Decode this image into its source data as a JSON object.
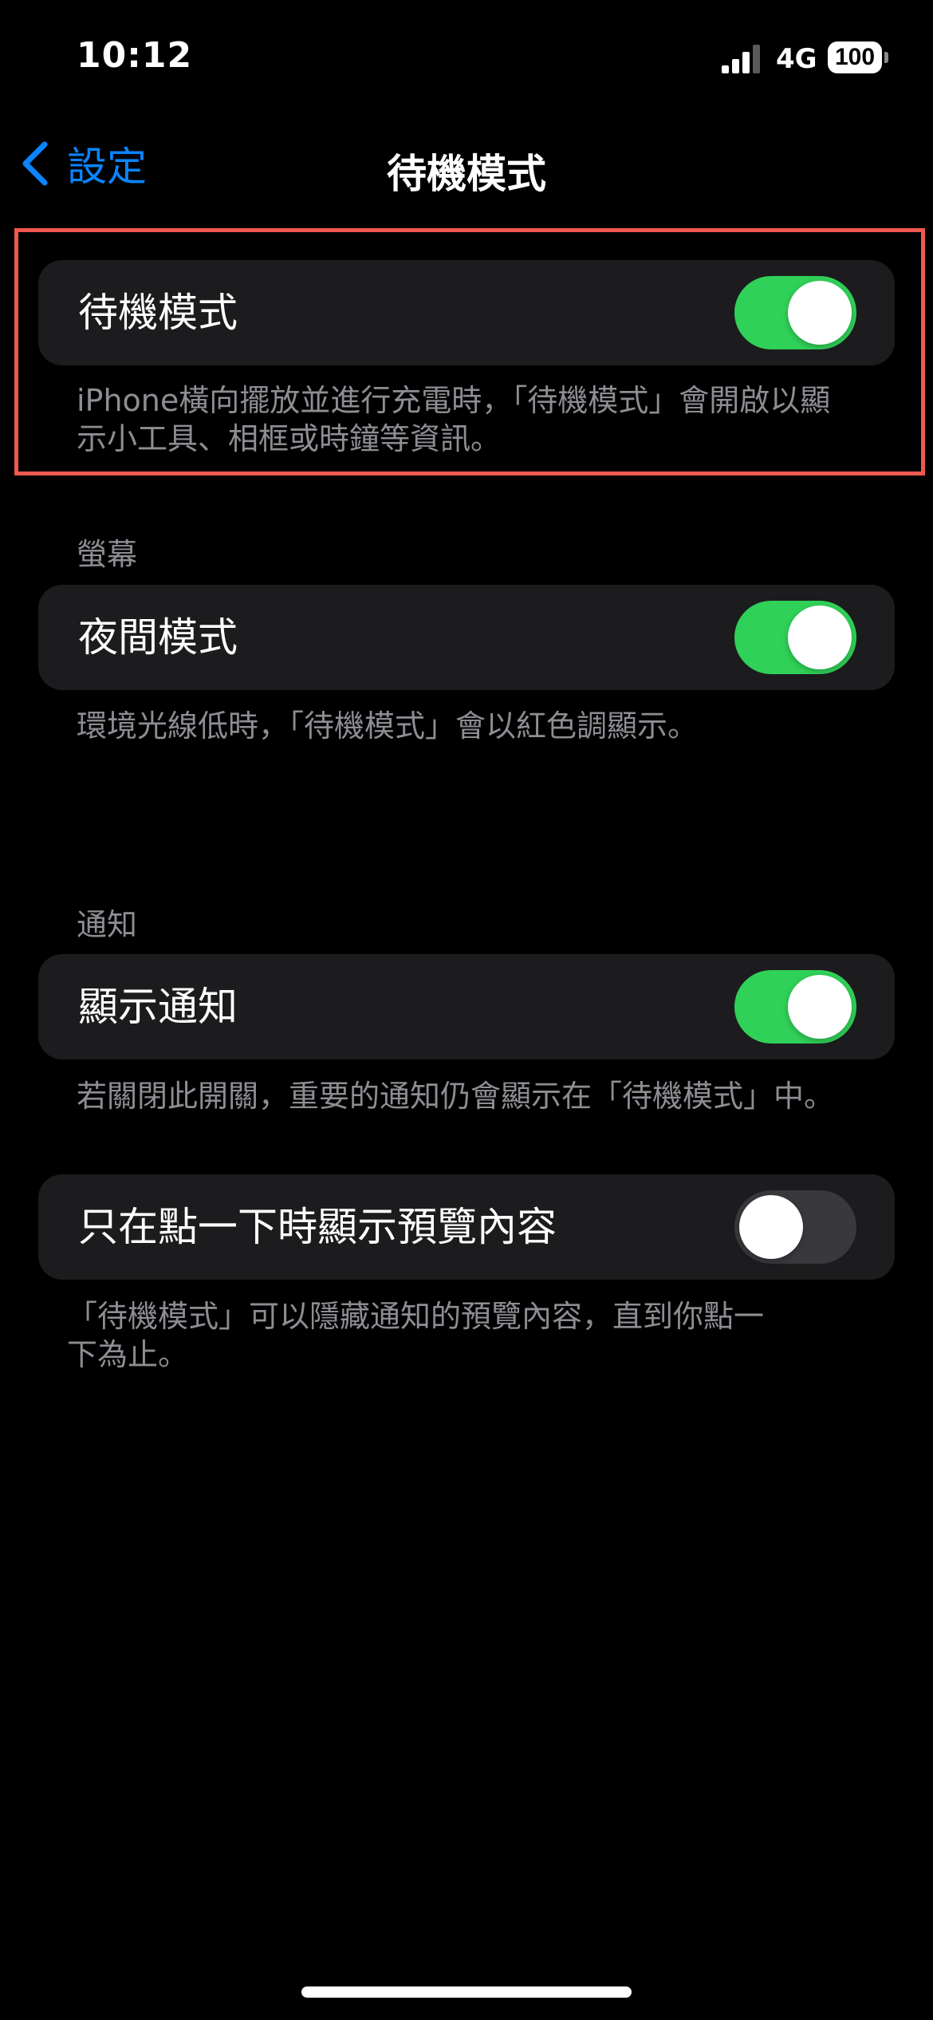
{
  "status_bar": {
    "time": "10:12",
    "network": "4G",
    "battery": "100"
  },
  "nav": {
    "back_label": "設定",
    "title": "待機模式"
  },
  "standby": {
    "label": "待機模式",
    "toggle_on": true,
    "footer": "iPhone橫向擺放並進行充電時，「待機模式」會開啟以顯示小工具、相框或時鐘等資訊。"
  },
  "display_section": {
    "header": "螢幕",
    "night_mode_label": "夜間模式",
    "night_mode_on": true,
    "footer": "環境光線低時，「待機模式」會以紅色調顯示。"
  },
  "notifications_section": {
    "header": "通知",
    "show_notifications_label": "顯示通知",
    "show_notifications_on": true,
    "show_notifications_footer": "若關閉此開關，重要的通知仍會顯示在「待機模式」中。",
    "preview_on_tap_label": "只在點一下時顯示預覽內容",
    "preview_on_tap_on": false,
    "preview_on_tap_footer": "「待機模式」可以隱藏通知的預覽內容，直到你點一下為止。"
  },
  "colors": {
    "accent": "#0a84ff",
    "toggle_on": "#30d158",
    "highlight": "#f0584e",
    "cell_background": "#1c1c1e"
  }
}
